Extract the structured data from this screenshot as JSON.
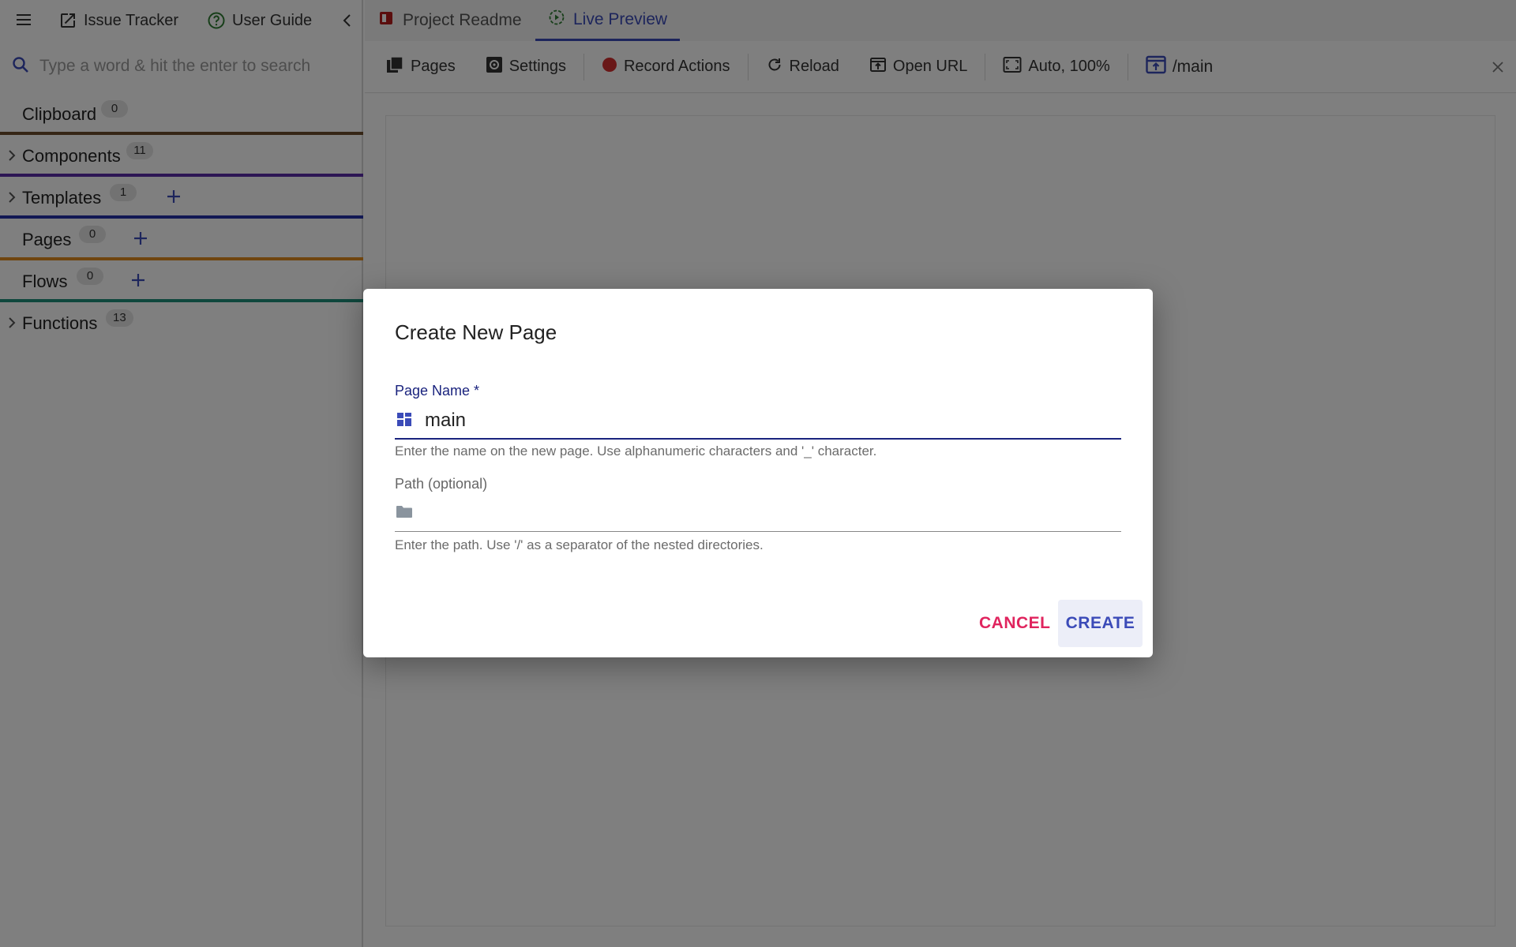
{
  "topbar": {
    "issue_tracker": "Issue Tracker",
    "user_guide": "User Guide"
  },
  "search": {
    "placeholder": "Type a word & hit the enter to search",
    "value": ""
  },
  "sidebar": {
    "sections": [
      {
        "title": "Clipboard",
        "count": "0",
        "expandable": false,
        "addable": false,
        "color": "#6d4c2d"
      },
      {
        "title": "Components",
        "count": "11",
        "expandable": true,
        "addable": false,
        "color": "#5b2ca8"
      },
      {
        "title": "Templates",
        "count": "1",
        "expandable": true,
        "addable": true,
        "color": "#2432a8"
      },
      {
        "title": "Pages",
        "count": "0",
        "expandable": false,
        "addable": true,
        "color": "#e08a1e"
      },
      {
        "title": "Flows",
        "count": "0",
        "expandable": false,
        "addable": true,
        "color": "#1f8f7a"
      },
      {
        "title": "Functions",
        "count": "13",
        "expandable": true,
        "addable": false,
        "color": "#cfcfcf"
      }
    ]
  },
  "tabs": [
    {
      "label": "Project Readme",
      "icon": "book-icon",
      "active": false
    },
    {
      "label": "Live Preview",
      "icon": "play-circle-icon",
      "active": true
    }
  ],
  "toolbar": {
    "pages": "Pages",
    "settings": "Settings",
    "record_actions": "Record Actions",
    "reload": "Reload",
    "open_url": "Open URL",
    "zoom": "Auto, 100%",
    "route": "/main"
  },
  "dialog": {
    "title": "Create New Page",
    "name_label": "Page Name *",
    "name_value": "main",
    "name_helper": "Enter the name on the new page. Use alphanumeric characters and '_' character.",
    "path_label": "Path (optional)",
    "path_value": "",
    "path_helper": "Enter the path. Use '/' as a separator of the nested directories.",
    "cancel": "CANCEL",
    "create": "CREATE"
  },
  "colors": {
    "accent": "#3b4bb8",
    "cancel": "#e0245e",
    "label_focus": "#1a237e",
    "record": "#d32f2f",
    "guide_icon": "#2e7d32"
  }
}
